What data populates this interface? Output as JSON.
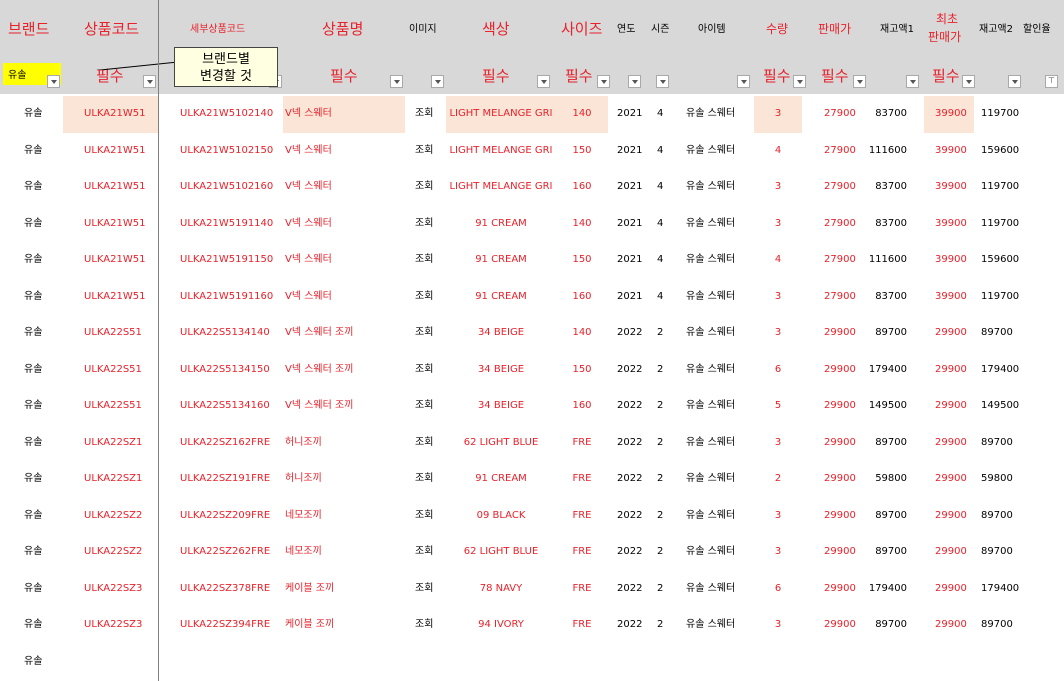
{
  "headers": {
    "brand": "브랜드",
    "product_code": "상품코드",
    "detail_code": "세부상품코드",
    "product_name": "상품명",
    "image": "이미지",
    "color": "색상",
    "size": "사이즈",
    "year": "연도",
    "season": "시즌",
    "item": "아이템",
    "qty": "수량",
    "price": "판매가",
    "stock1": "재고액1",
    "initial_price_line1": "최초",
    "initial_price_line2": "판매가",
    "stock2": "재고액2",
    "discount": "할인율"
  },
  "required_label": "필수",
  "brand_filter_value": "유솔",
  "comment": {
    "line1": "브랜드별",
    "line2": "변경할 것"
  },
  "rows": [
    {
      "brand": "유솔",
      "code": "ULKA21W51",
      "detail": "ULKA21W5102140",
      "name": "V넥 스웨터",
      "image": "조회",
      "color": "LIGHT MELANGE GRI",
      "size": "140",
      "year": "2021",
      "season": "4",
      "item": "유솔 스웨터",
      "qty": "3",
      "price": "27900",
      "stock1": "83700",
      "init": "39900",
      "stock2": "119700"
    },
    {
      "brand": "유솔",
      "code": "ULKA21W51",
      "detail": "ULKA21W5102150",
      "name": "V넥 스웨터",
      "image": "조회",
      "color": "LIGHT MELANGE GRI",
      "size": "150",
      "year": "2021",
      "season": "4",
      "item": "유솔 스웨터",
      "qty": "4",
      "price": "27900",
      "stock1": "111600",
      "init": "39900",
      "stock2": "159600"
    },
    {
      "brand": "유솔",
      "code": "ULKA21W51",
      "detail": "ULKA21W5102160",
      "name": "V넥 스웨터",
      "image": "조회",
      "color": "LIGHT MELANGE GRI",
      "size": "160",
      "year": "2021",
      "season": "4",
      "item": "유솔 스웨터",
      "qty": "3",
      "price": "27900",
      "stock1": "83700",
      "init": "39900",
      "stock2": "119700"
    },
    {
      "brand": "유솔",
      "code": "ULKA21W51",
      "detail": "ULKA21W5191140",
      "name": "V넥 스웨터",
      "image": "조회",
      "color": "91 CREAM",
      "size": "140",
      "year": "2021",
      "season": "4",
      "item": "유솔 스웨터",
      "qty": "3",
      "price": "27900",
      "stock1": "83700",
      "init": "39900",
      "stock2": "119700"
    },
    {
      "brand": "유솔",
      "code": "ULKA21W51",
      "detail": "ULKA21W5191150",
      "name": "V넥 스웨터",
      "image": "조회",
      "color": "91 CREAM",
      "size": "150",
      "year": "2021",
      "season": "4",
      "item": "유솔 스웨터",
      "qty": "4",
      "price": "27900",
      "stock1": "111600",
      "init": "39900",
      "stock2": "159600"
    },
    {
      "brand": "유솔",
      "code": "ULKA21W51",
      "detail": "ULKA21W5191160",
      "name": "V넥 스웨터",
      "image": "조회",
      "color": "91 CREAM",
      "size": "160",
      "year": "2021",
      "season": "4",
      "item": "유솔 스웨터",
      "qty": "3",
      "price": "27900",
      "stock1": "83700",
      "init": "39900",
      "stock2": "119700"
    },
    {
      "brand": "유솔",
      "code": "ULKA22S51",
      "detail": "ULKA22S5134140",
      "name": "V넥 스웨터 조끼",
      "image": "조회",
      "color": "34 BEIGE",
      "size": "140",
      "year": "2022",
      "season": "2",
      "item": "유솔 스웨터",
      "qty": "3",
      "price": "29900",
      "stock1": "89700",
      "init": "29900",
      "stock2": "89700"
    },
    {
      "brand": "유솔",
      "code": "ULKA22S51",
      "detail": "ULKA22S5134150",
      "name": "V넥 스웨터 조끼",
      "image": "조회",
      "color": "34 BEIGE",
      "size": "150",
      "year": "2022",
      "season": "2",
      "item": "유솔 스웨터",
      "qty": "6",
      "price": "29900",
      "stock1": "179400",
      "init": "29900",
      "stock2": "179400"
    },
    {
      "brand": "유솔",
      "code": "ULKA22S51",
      "detail": "ULKA22S5134160",
      "name": "V넥 스웨터 조끼",
      "image": "조회",
      "color": "34 BEIGE",
      "size": "160",
      "year": "2022",
      "season": "2",
      "item": "유솔 스웨터",
      "qty": "5",
      "price": "29900",
      "stock1": "149500",
      "init": "29900",
      "stock2": "149500"
    },
    {
      "brand": "유솔",
      "code": "ULKA22SZ1",
      "detail": "ULKA22SZ162FRE",
      "name": "허니조끼",
      "image": "조회",
      "color": "62 LIGHT BLUE",
      "size": "FRE",
      "year": "2022",
      "season": "2",
      "item": "유솔 스웨터",
      "qty": "3",
      "price": "29900",
      "stock1": "89700",
      "init": "29900",
      "stock2": "89700"
    },
    {
      "brand": "유솔",
      "code": "ULKA22SZ1",
      "detail": "ULKA22SZ191FRE",
      "name": "허니조끼",
      "image": "조회",
      "color": "91 CREAM",
      "size": "FRE",
      "year": "2022",
      "season": "2",
      "item": "유솔 스웨터",
      "qty": "2",
      "price": "29900",
      "stock1": "59800",
      "init": "29900",
      "stock2": "59800"
    },
    {
      "brand": "유솔",
      "code": "ULKA22SZ2",
      "detail": "ULKA22SZ209FRE",
      "name": "네모조끼",
      "image": "조회",
      "color": "09 BLACK",
      "size": "FRE",
      "year": "2022",
      "season": "2",
      "item": "유솔 스웨터",
      "qty": "3",
      "price": "29900",
      "stock1": "89700",
      "init": "29900",
      "stock2": "89700"
    },
    {
      "brand": "유솔",
      "code": "ULKA22SZ2",
      "detail": "ULKA22SZ262FRE",
      "name": "네모조끼",
      "image": "조회",
      "color": "62 LIGHT BLUE",
      "size": "FRE",
      "year": "2022",
      "season": "2",
      "item": "유솔 스웨터",
      "qty": "3",
      "price": "29900",
      "stock1": "89700",
      "init": "29900",
      "stock2": "89700"
    },
    {
      "brand": "유솔",
      "code": "ULKA22SZ3",
      "detail": "ULKA22SZ378FRE",
      "name": "케이블 조끼",
      "image": "조회",
      "color": "78 NAVY",
      "size": "FRE",
      "year": "2022",
      "season": "2",
      "item": "유솔 스웨터",
      "qty": "6",
      "price": "29900",
      "stock1": "179400",
      "init": "29900",
      "stock2": "179400"
    },
    {
      "brand": "유솔",
      "code": "ULKA22SZ3",
      "detail": "ULKA22SZ394FRE",
      "name": "케이블 조끼",
      "image": "조회",
      "color": "94 IVORY",
      "size": "FRE",
      "year": "2022",
      "season": "2",
      "item": "유솔 스웨터",
      "qty": "3",
      "price": "29900",
      "stock1": "89700",
      "init": "29900",
      "stock2": "89700"
    },
    {
      "brand": "유솔"
    }
  ],
  "colors": {
    "header_bg": "#d8d8d8",
    "red_text": "#e8212a",
    "highlight": "#fbe5d6",
    "brand_yellow": "#ffff00",
    "comment_bg": "#ffffe1"
  }
}
